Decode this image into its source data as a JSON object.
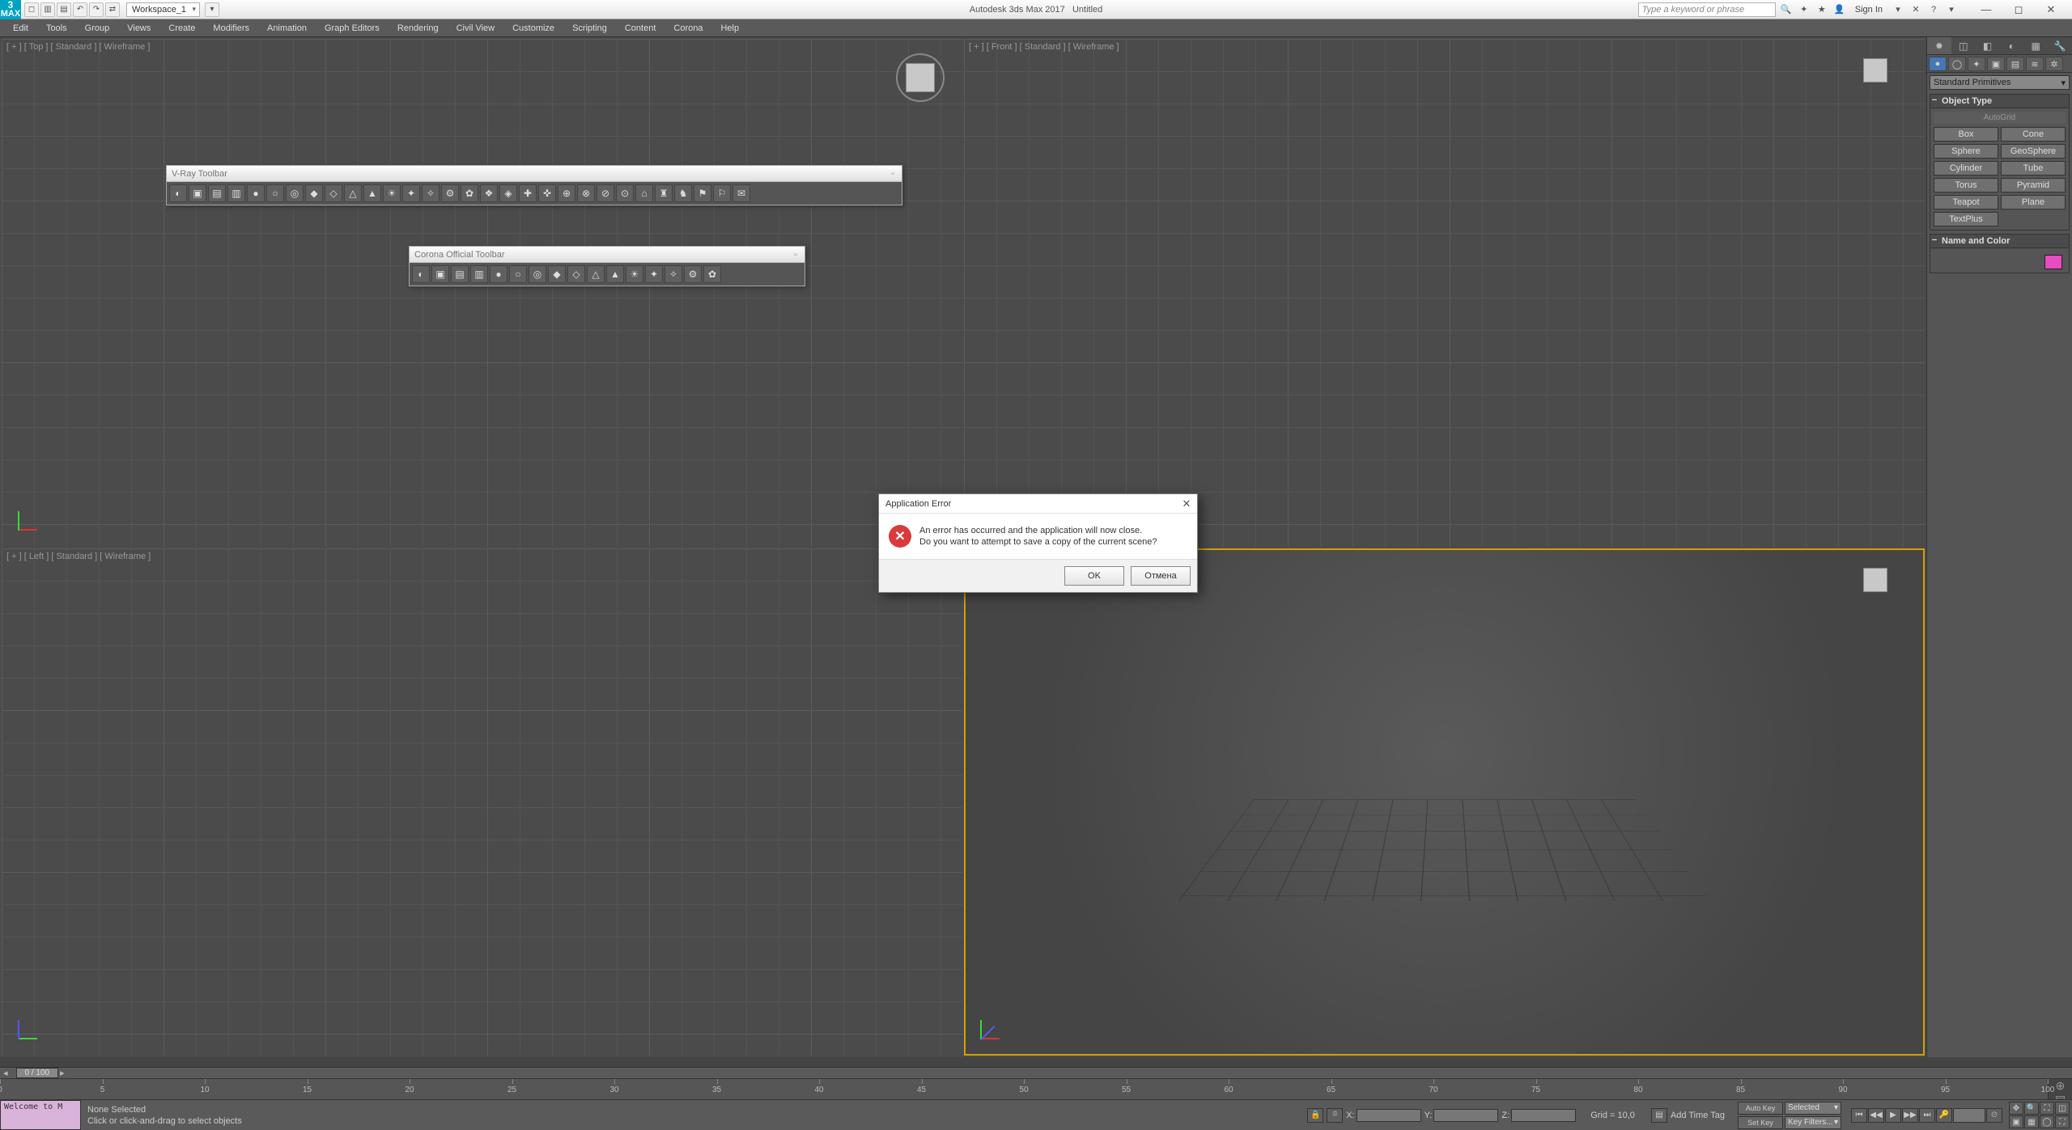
{
  "app": {
    "title": "Autodesk 3ds Max 2017",
    "document": "Untitled",
    "workspace": "Workspace_1"
  },
  "titlebar": {
    "search_placeholder": "Type a keyword or phrase",
    "signin": "Sign In"
  },
  "menu": [
    "Edit",
    "Tools",
    "Group",
    "Views",
    "Create",
    "Modifiers",
    "Animation",
    "Graph Editors",
    "Rendering",
    "Civil View",
    "Customize",
    "Scripting",
    "Content",
    "Corona",
    "Help"
  ],
  "viewports": {
    "top": "[ + ] [ Top ] [ Standard ] [ Wireframe ]",
    "front": "[ + ] [ Front ] [ Standard ] [ Wireframe ]",
    "left": "[ + ] [ Left ] [ Standard ] [ Wireframe ]",
    "persp": ""
  },
  "float1": {
    "title": "V-Ray Toolbar"
  },
  "float2": {
    "title": "Corona Official Toolbar"
  },
  "cmdpanel": {
    "dropdown": "Standard Primitives",
    "roll_objtype": "Object Type",
    "autogrid": "AutoGrid",
    "prims": [
      "Box",
      "Cone",
      "Sphere",
      "GeoSphere",
      "Cylinder",
      "Tube",
      "Torus",
      "Pyramid",
      "Teapot",
      "Plane",
      "TextPlus",
      ""
    ],
    "roll_namecolor": "Name and Color"
  },
  "timeslider": {
    "label": "0 / 100"
  },
  "ruler_ticks": [
    0,
    5,
    10,
    15,
    20,
    25,
    30,
    35,
    40,
    45,
    50,
    55,
    60,
    65,
    70,
    75,
    80,
    85,
    90,
    95,
    100
  ],
  "status": {
    "script_prompt": "Welcome to M",
    "sel": "None Selected",
    "hint": "Click or click-and-drag to select objects",
    "x_label": "X:",
    "y_label": "Y:",
    "z_label": "Z:",
    "grid": "Grid = 10,0",
    "addtag": "Add Time Tag",
    "autokey": "Auto Key",
    "setkey": "Set Key",
    "keymode": "Selected",
    "keyfilters": "Key Filters..."
  },
  "dialog": {
    "title": "Application Error",
    "line1": "An error has occurred and the application will now close.",
    "line2": "Do you want to attempt to save a copy of the current scene?",
    "ok": "OK",
    "cancel": "Отмена"
  }
}
